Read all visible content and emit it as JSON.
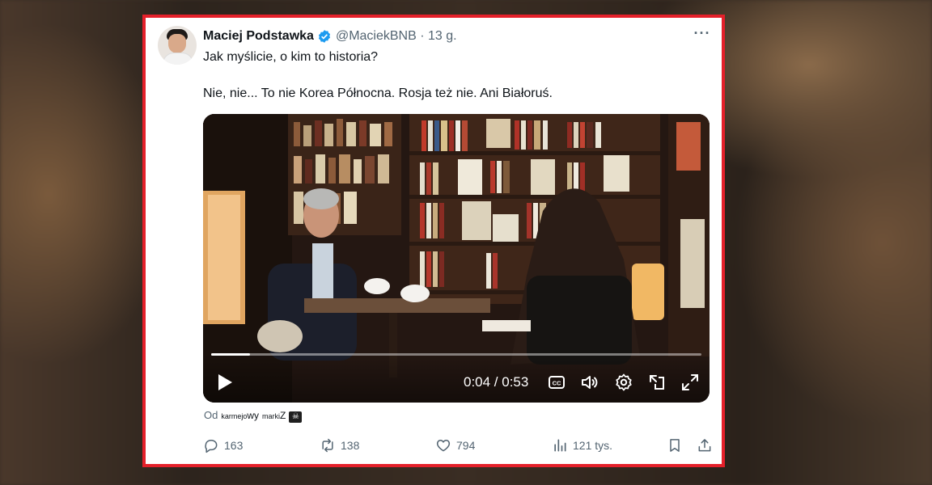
{
  "tweet": {
    "author_name": "Maciej Podstawka",
    "handle_time": "@MaciekBNB · 13 g.",
    "line1": "Jak myślicie, o kim to historia?",
    "line2": "Nie, nie... To nie Korea Północna. Rosja też nie. Ani Białoruś."
  },
  "video": {
    "time_display": "0:04 / 0:53",
    "progress": 0.08
  },
  "source": {
    "prefix": "Od",
    "part1": "karmejo",
    "part2": "wy",
    "part3": "marki",
    "part4": "Z",
    "badge": "☠"
  },
  "actions": {
    "replies": "163",
    "reposts": "138",
    "likes": "794",
    "views": "121 tys."
  },
  "colors": {
    "frame_border": "#e4202a",
    "verified": "#1d9bf0",
    "text_secondary": "#536471"
  },
  "icons": [
    "verified-badge-icon",
    "more-icon",
    "play-icon",
    "captions-icon",
    "volume-icon",
    "settings-icon",
    "pip-icon",
    "fullscreen-icon",
    "reply-icon",
    "repost-icon",
    "like-icon",
    "views-icon",
    "bookmark-icon",
    "share-icon"
  ]
}
